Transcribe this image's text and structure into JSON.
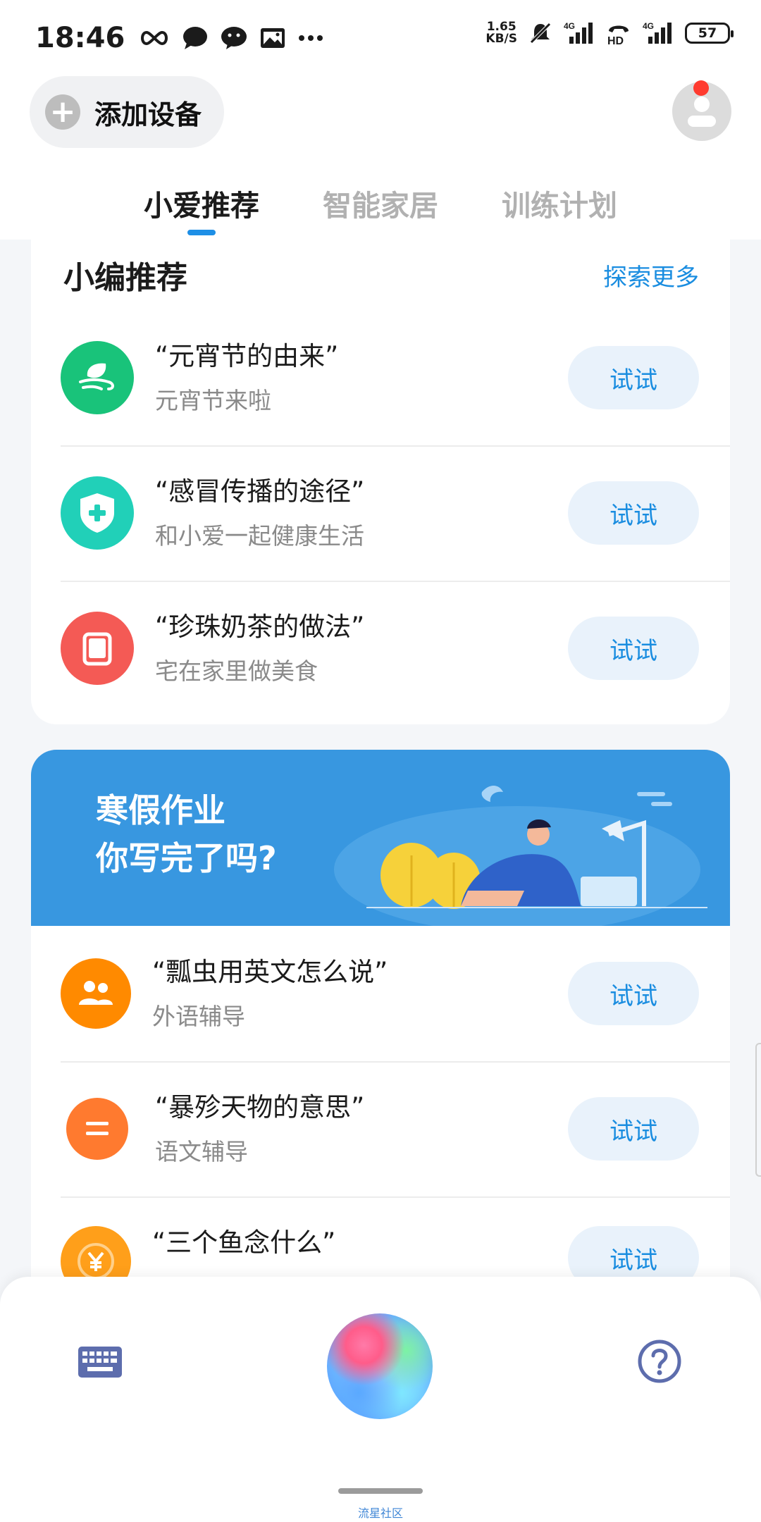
{
  "status_bar": {
    "time": "18:46",
    "speed_value": "1.65",
    "speed_unit": "KB/S",
    "battery": "57",
    "network_1": "4G",
    "network_2": "HD",
    "network_3": "4G"
  },
  "header": {
    "add_device_label": "添加设备",
    "has_notification": true
  },
  "tabs": [
    {
      "label": "小爱推荐",
      "active": true
    },
    {
      "label": "智能家居",
      "active": false
    },
    {
      "label": "训练计划",
      "active": false
    }
  ],
  "editor_picks": {
    "title": "小编推荐",
    "explore_label": "探索更多",
    "items": [
      {
        "title": "“元宵节的由来”",
        "subtitle": "元宵节来啦",
        "button": "试试",
        "icon": "leaf-wind-icon",
        "color": "#19c37a"
      },
      {
        "title": "“感冒传播的途径”",
        "subtitle": "和小爱一起健康生活",
        "button": "试试",
        "icon": "shield-plus-icon",
        "color": "#21d0b8"
      },
      {
        "title": "“珍珠奶茶的做法”",
        "subtitle": "宅在家里做美食",
        "button": "试试",
        "icon": "book-icon",
        "color": "#f45a55"
      }
    ]
  },
  "banner": {
    "line1": "寒假作业",
    "line2": "你写完了吗?",
    "color": "#3897e0"
  },
  "homework": {
    "items": [
      {
        "title": "“瓢虫用英文怎么说”",
        "subtitle": "外语辅导",
        "button": "试试",
        "icon": "people-icon",
        "color": "#ff8a00"
      },
      {
        "title": "“暴殄天物的意思”",
        "subtitle": "语文辅导",
        "button": "试试",
        "icon": "equals-icon",
        "color": "#ff7a2f"
      },
      {
        "title": "“三个鱼念什么”",
        "subtitle": "",
        "button": "试试",
        "icon": "yen-coin-icon",
        "color": "#ff9f1a"
      }
    ]
  },
  "bottom_bar": {
    "keyboard_icon": "keyboard-icon",
    "voice_icon": "voice-orb-icon",
    "help_icon": "help-icon",
    "caption": "流星社区"
  },
  "accent_color": "#1a8de0"
}
